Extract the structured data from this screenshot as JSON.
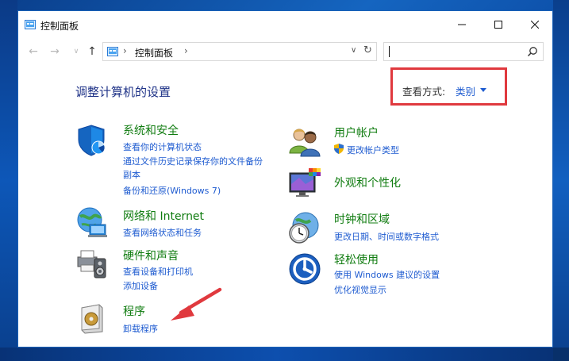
{
  "window": {
    "title": "控制面板",
    "controls": {
      "minimize": "—",
      "maximize": "☐",
      "close": "✕"
    }
  },
  "nav": {
    "back": "←",
    "forward": "→",
    "recent": "∨",
    "up": "↑",
    "separator": "›",
    "address": "控制面板",
    "dropdown": "∨",
    "refresh": "↻",
    "search_value": ""
  },
  "main": {
    "heading": "调整计算机的设置",
    "view_by": {
      "label": "查看方式:",
      "value": "类别"
    }
  },
  "categories": [
    {
      "title": "系统和安全",
      "icon": "shield-icon",
      "links": [
        "查看你的计算机状态",
        "通过文件历史记录保存你的文件备份",
        "副本",
        "备份和还原(Windows 7)"
      ]
    },
    {
      "title": "网络和 Internet",
      "icon": "network-globe-icon",
      "links": [
        "查看网络状态和任务"
      ]
    },
    {
      "title": "硬件和声音",
      "icon": "printer-speaker-icon",
      "links": [
        "查看设备和打印机",
        "添加设备"
      ]
    },
    {
      "title": "程序",
      "icon": "programs-disk-icon",
      "links": [
        "卸载程序"
      ]
    },
    {
      "title": "用户帐户",
      "icon": "users-icon",
      "links": [
        "更改帐户类型"
      ]
    },
    {
      "title": "外观和个性化",
      "icon": "display-colors-icon",
      "links": []
    },
    {
      "title": "时钟和区域",
      "icon": "clock-globe-icon",
      "links": [
        "更改日期、时间或数字格式"
      ]
    },
    {
      "title": "轻松使用",
      "icon": "ease-of-access-icon",
      "links": [
        "使用 Windows 建议的设置",
        "优化视觉显示"
      ]
    }
  ],
  "colors": {
    "category_title": "#107c10",
    "link": "#1e5bd0",
    "heading": "#1e3287",
    "highlight_box": "#e0393e",
    "annotation_arrow": "#e0393e",
    "desktop": "#1565c0"
  }
}
